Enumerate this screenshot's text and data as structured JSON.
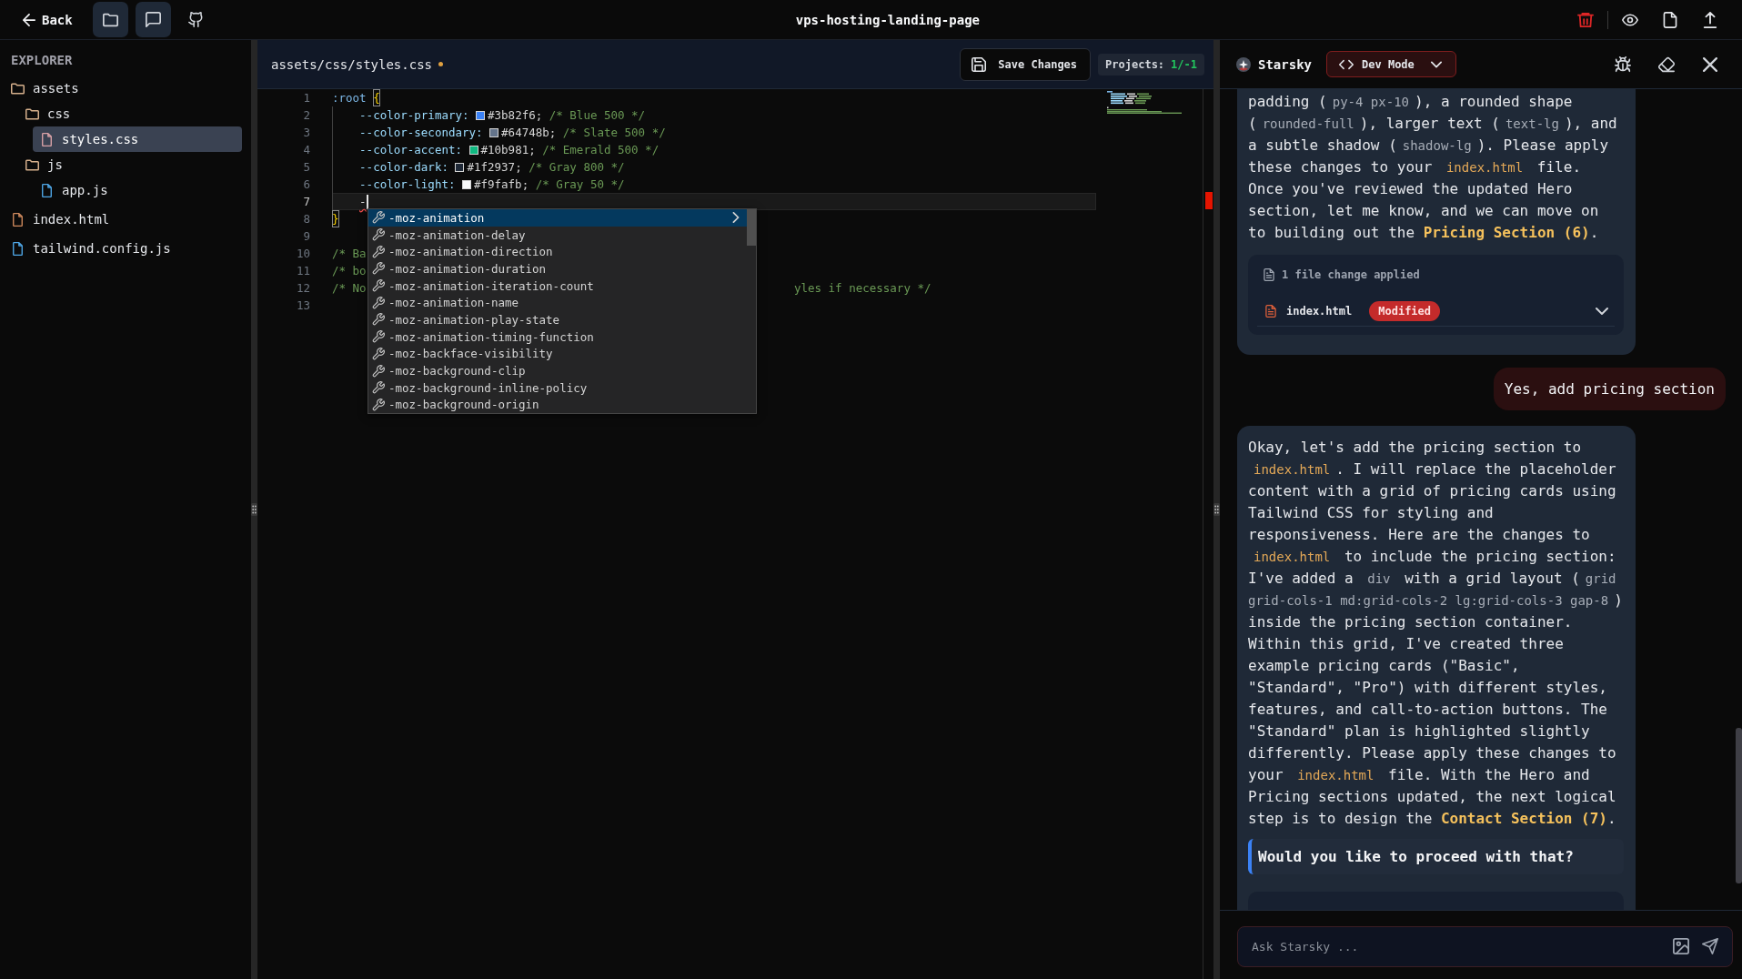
{
  "topbar": {
    "back": "Back",
    "toolbar": [
      {
        "kind": "folder",
        "on": true
      },
      {
        "kind": "chat",
        "on": true
      },
      {
        "kind": "github",
        "on": false
      }
    ],
    "title": "vps-hosting-landing-page"
  },
  "explorer": {
    "title": "EXPLORER",
    "tree": [
      {
        "name": "assets",
        "kind": "folder",
        "color": "#d6b08c",
        "selected": false,
        "children": [
          {
            "name": "css",
            "kind": "folder",
            "color": "#d6b08c",
            "selected": false,
            "children": [
              {
                "name": "styles.css",
                "kind": "file",
                "color": "#dba3a8",
                "selected": true
              }
            ]
          },
          {
            "name": "js",
            "kind": "folder",
            "color": "#d6b08c",
            "selected": false,
            "children": [
              {
                "name": "app.js",
                "kind": "file",
                "color": "#4fa8e8",
                "selected": false
              }
            ]
          }
        ]
      },
      {
        "name": "index.html",
        "kind": "file",
        "color": "#d08a5e",
        "selected": false
      },
      {
        "name": "tailwind.config.js",
        "kind": "file",
        "color": "#4fa8e8",
        "selected": false
      }
    ]
  },
  "editor": {
    "path": "assets/css/styles.css",
    "unsaved": true,
    "save_button": "Save Changes",
    "projects": {
      "label": "Projects:",
      "value": "1/-1"
    },
    "lines": [
      {
        "num": "1",
        "kind": "selector",
        "selector": ":root",
        "brace": {
          "char": "{",
          "matched": true
        },
        "current": false
      },
      {
        "num": "2",
        "kind": "property",
        "name": "--color-primary:",
        "color": "#3b82f6",
        "value": "#3b82f6;",
        "comment": "/* Blue 500 */",
        "current": false
      },
      {
        "num": "3",
        "kind": "property",
        "name": "--color-secondary:",
        "color": "#64748b",
        "value": "#64748b;",
        "comment": "/* Slate 500 */",
        "current": false
      },
      {
        "num": "4",
        "kind": "property",
        "name": "--color-accent:",
        "color": "#10b981",
        "value": "#10b981;",
        "comment": "/* Emerald 500 */",
        "current": false
      },
      {
        "num": "5",
        "kind": "property",
        "name": "--color-dark:",
        "color": "#1f2937",
        "value": "#1f2937;",
        "comment": "/* Gray 800 */",
        "current": false
      },
      {
        "num": "6",
        "kind": "property",
        "name": "--color-light:",
        "color": "#f9fafb",
        "value": "#f9fafb;",
        "comment": "/* Gray 50 */",
        "current": false
      },
      {
        "num": "7",
        "kind": "typing",
        "text": "-",
        "error": true,
        "current": true
      },
      {
        "num": "8",
        "kind": "close",
        "brace": {
          "char": "}",
          "matched": true
        },
        "current": false
      },
      {
        "num": "9",
        "kind": "blank",
        "current": false
      },
      {
        "num": "10",
        "kind": "comment",
        "text": "/* Ba",
        "current": false
      },
      {
        "num": "11",
        "kind": "comment",
        "text": "/* bo",
        "current": false
      },
      {
        "num": "12",
        "kind": "comment",
        "text": "/* No",
        "tail": "yles if necessary */",
        "current": false
      },
      {
        "num": "13",
        "kind": "blank",
        "current": false
      }
    ],
    "suggestions": [
      {
        "label": "-moz-animation",
        "selected": true
      },
      {
        "label": "-moz-animation-delay",
        "selected": false
      },
      {
        "label": "-moz-animation-direction",
        "selected": false
      },
      {
        "label": "-moz-animation-duration",
        "selected": false
      },
      {
        "label": "-moz-animation-iteration-count",
        "selected": false
      },
      {
        "label": "-moz-animation-name",
        "selected": false
      },
      {
        "label": "-moz-animation-play-state",
        "selected": false
      },
      {
        "label": "-moz-animation-timing-function",
        "selected": false
      },
      {
        "label": "-moz-backface-visibility",
        "selected": false
      },
      {
        "label": "-moz-background-clip",
        "selected": false
      },
      {
        "label": "-moz-background-inline-policy",
        "selected": false
      },
      {
        "label": "-moz-background-origin",
        "selected": false
      }
    ]
  },
  "chat": {
    "name": "Starsky",
    "mode": "Dev Mode",
    "messages": [
      {
        "kind": "assistant",
        "segments": [
          {
            "kind": "text",
            "text": "padding ("
          },
          {
            "kind": "code",
            "text": "py-4 px-10"
          },
          {
            "kind": "text",
            "text": "), a rounded shape ("
          },
          {
            "kind": "code",
            "text": "rounded-full"
          },
          {
            "kind": "text",
            "text": "), larger text ("
          },
          {
            "kind": "code",
            "text": "text-lg"
          },
          {
            "kind": "text",
            "text": "), and a subtle shadow ("
          },
          {
            "kind": "code",
            "text": "shadow-lg"
          },
          {
            "kind": "text",
            "text": "). Please apply these changes to your "
          },
          {
            "kind": "file",
            "text": "index.html"
          },
          {
            "kind": "text",
            "text": " file. Once you've reviewed the updated Hero section, let me know, and we can move on to building out the "
          },
          {
            "kind": "strong",
            "text": "Pricing Section (6)"
          },
          {
            "kind": "text",
            "text": "."
          }
        ],
        "changes": {
          "summary": "1 file change applied",
          "files": [
            {
              "name": "index.html",
              "status": "Modified",
              "expanded": false
            }
          ]
        }
      },
      {
        "kind": "user",
        "text": "Yes, add pricing section"
      },
      {
        "kind": "assistant",
        "segments": [
          {
            "kind": "text",
            "text": "Okay, let's add the pricing section to "
          },
          {
            "kind": "file",
            "text": "index.html"
          },
          {
            "kind": "text",
            "text": ". I will replace the placeholder content with a grid of pricing cards using Tailwind CSS for styling and responsiveness. Here are the changes to "
          },
          {
            "kind": "file",
            "text": "index.html"
          },
          {
            "kind": "text",
            "text": " to include the pricing section: I've added a "
          },
          {
            "kind": "code",
            "text": "div"
          },
          {
            "kind": "text",
            "text": " with a grid layout ("
          },
          {
            "kind": "code",
            "text": "grid grid-cols-1 md:grid-cols-2 lg:grid-cols-3 gap-8"
          },
          {
            "kind": "text",
            "text": ") inside the pricing section container. Within this grid, I've created three example pricing cards (\"Basic\", \"Standard\", \"Pro\") with different styles, features, and call-to-action buttons. The \"Standard\" plan is highlighted slightly differently. Please apply these changes to your "
          },
          {
            "kind": "file",
            "text": "index.html"
          },
          {
            "kind": "text",
            "text": " file. With the Hero and Pricing sections updated, the next logical step is to design the "
          },
          {
            "kind": "strong",
            "text": "Contact Section (7)"
          },
          {
            "kind": "text",
            "text": "."
          }
        ],
        "quote": "Would you like to proceed with that?",
        "more_below": true
      }
    ],
    "input": {
      "placeholder": "Ask Starsky ..."
    }
  }
}
